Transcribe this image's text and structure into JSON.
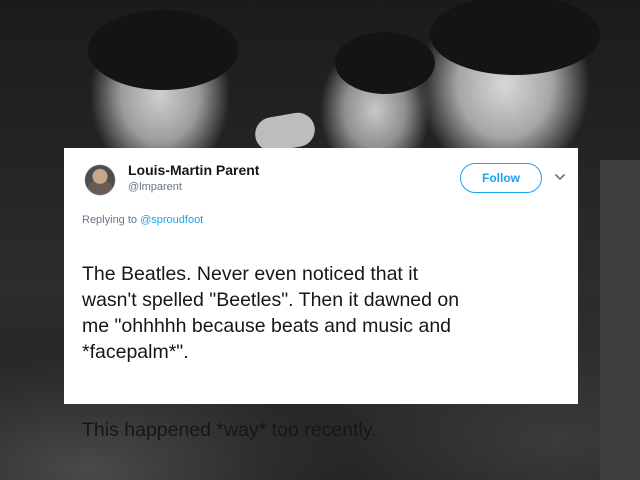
{
  "tweet": {
    "display_name": "Louis-Martin Parent",
    "handle": "@lmparent",
    "follow_label": "Follow",
    "replying_to_prefix": "Replying to ",
    "replying_to_handle": "@sproudfoot",
    "paragraph_1": "The Beatles. Never even noticed that it\nwasn't spelled \"Beetles\". Then it dawned on\nme \"ohhhhh because beats and music and\n*facepalm*\".",
    "paragraph_2": "This happened *way* too recently."
  },
  "colors": {
    "accent": "#1da1f2",
    "text_primary": "#14171a",
    "text_secondary": "#657786",
    "card_background": "#ffffff"
  },
  "icons": {
    "avatar": "profile-photo",
    "menu": "chevron-down-icon"
  }
}
